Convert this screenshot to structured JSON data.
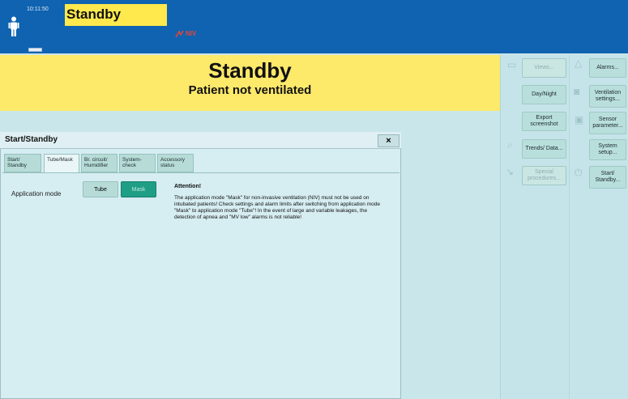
{
  "header": {
    "time": "10:11:50",
    "mode": "Standby",
    "niv_label": "NIV"
  },
  "banner": {
    "title": "Standby",
    "subtitle": "Patient not ventilated"
  },
  "right_panel": {
    "left_column": [
      {
        "label": "Views...",
        "icon": "views-icon",
        "enabled": false
      },
      {
        "label": "Day/Night",
        "icon": "",
        "enabled": true
      },
      {
        "label": "Export screenshot",
        "icon": "",
        "enabled": true
      },
      {
        "label": "Trends/ Data...",
        "icon": "trends-icon",
        "enabled": true
      },
      {
        "label": "Special procedures...",
        "icon": "special-procedures-icon",
        "enabled": false
      }
    ],
    "right_column": [
      {
        "label": "Alarms...",
        "icon": "alarm-icon",
        "enabled": true
      },
      {
        "label": "Ventilation settings...",
        "icon": "ventilation-icon",
        "enabled": true
      },
      {
        "label": "Sensor parameter...",
        "icon": "sensor-icon",
        "enabled": true
      },
      {
        "label": "System setup...",
        "icon": "",
        "enabled": true
      },
      {
        "label": "Start/ Standby...",
        "icon": "power-icon",
        "enabled": true
      }
    ]
  },
  "dialog": {
    "title": "Start/Standby",
    "close": "×",
    "tabs": [
      {
        "label": "Start/ Standby",
        "active": false
      },
      {
        "label": "Tube/Mask",
        "active": true
      },
      {
        "label": "Br. circuit/ Humidifier",
        "active": false
      },
      {
        "label": "System-check",
        "active": false
      },
      {
        "label": "Accessory status",
        "active": false
      }
    ],
    "application_mode_label": "Application mode",
    "tube_label": "Tube",
    "mask_label": "Mask",
    "attention_title": "Attention!",
    "attention_text": "The application mode \"Mask\" for non-invasive ventilation (NIV) must not be used on intubated patients! Check settings and alarm limits after switching from application mode \"Mask\" to application mode \"Tube\"! In the event of large and variable leakages, the detection of apnea and \"MV low\" alarms is not reliable!"
  }
}
